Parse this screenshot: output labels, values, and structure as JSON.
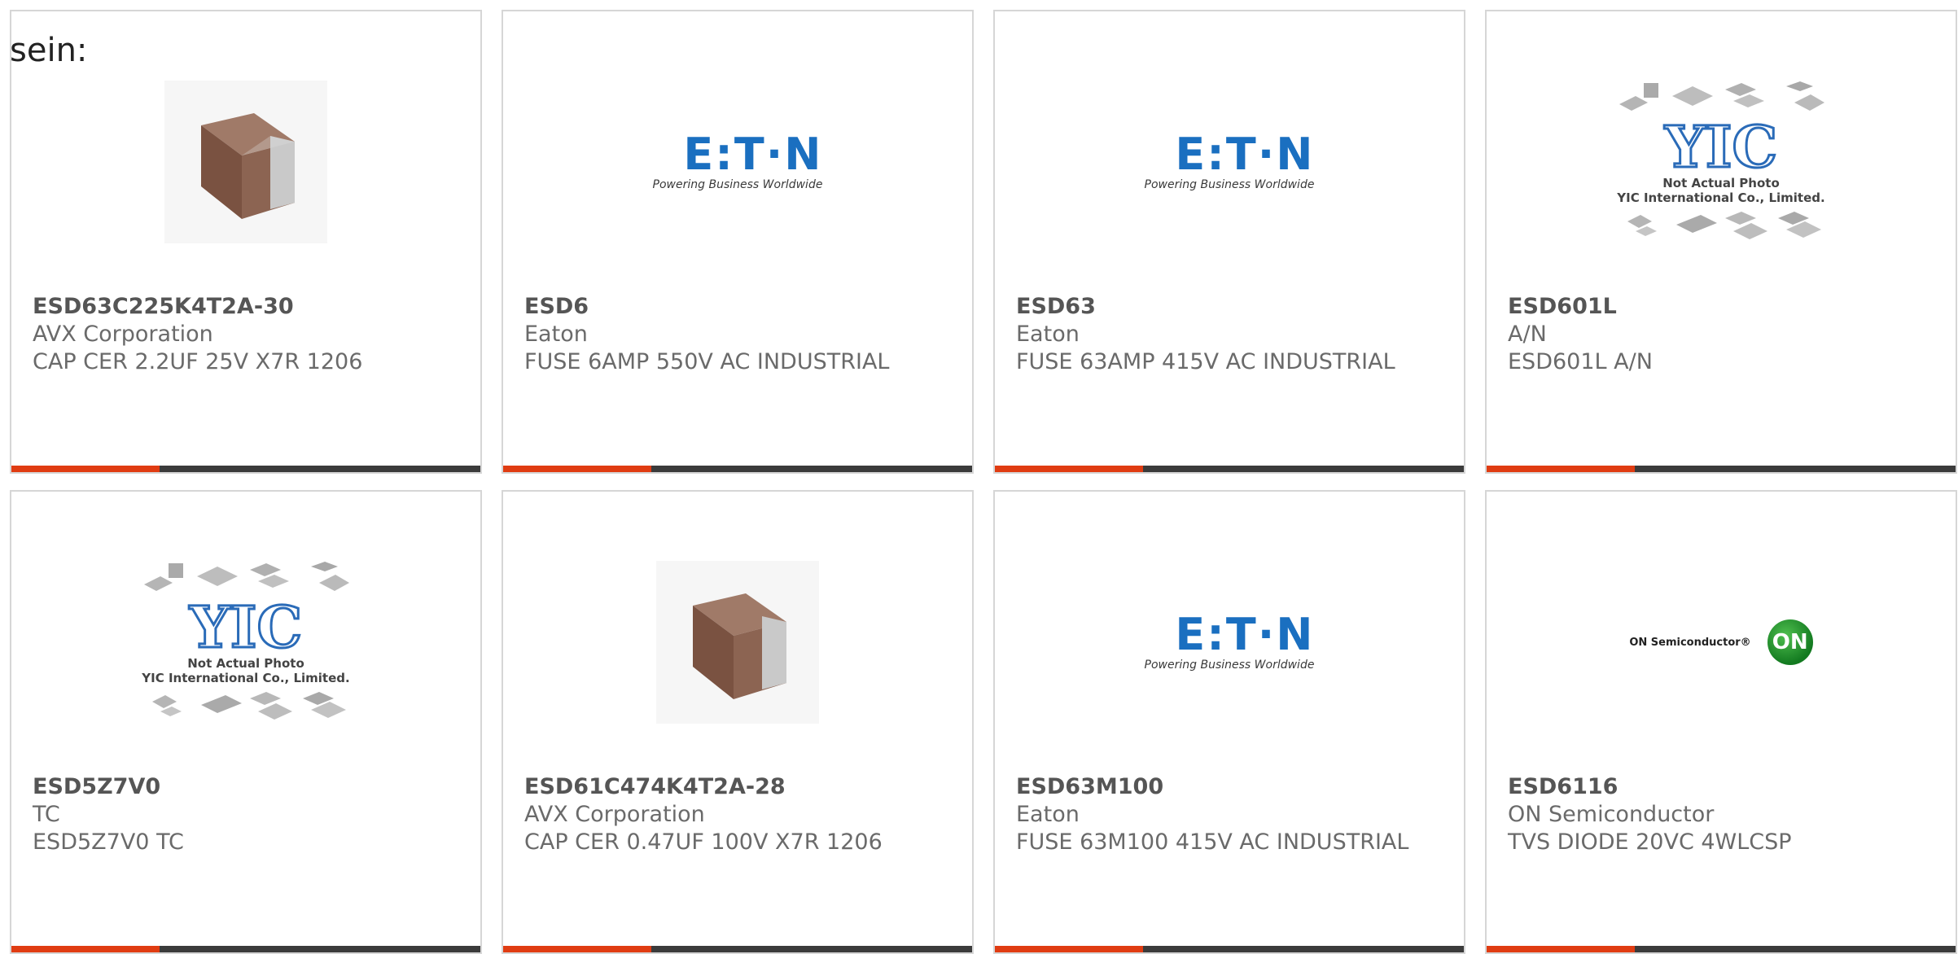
{
  "intro_text": "sein:",
  "colors": {
    "accent": "#e03c12",
    "bar_dark": "#3b3b3b",
    "eaton_blue": "#1a6fc0",
    "on_green": "#137a20",
    "yic_blue": "#2a6bb8"
  },
  "logos": {
    "eaton_word": "E:T·N",
    "eaton_tag": "Powering Business Worldwide",
    "yic_mark": "YIC",
    "yic_caption1": "Not Actual Photo",
    "yic_caption2": "YIC International Co., Limited.",
    "on_name": "ON Semiconductor®",
    "on_mark": "ON"
  },
  "products": [
    {
      "part": "ESD63C225K4T2A-30",
      "manufacturer": "AVX Corporation",
      "description": "CAP CER 2.2UF 25V X7R 1206",
      "image": "capacitor-chip"
    },
    {
      "part": "ESD6",
      "manufacturer": "Eaton",
      "description": "FUSE 6AMP 550V AC INDUSTRIAL",
      "image": "eaton-logo"
    },
    {
      "part": "ESD63",
      "manufacturer": "Eaton",
      "description": "FUSE 63AMP 415V AC INDUSTRIAL",
      "image": "eaton-logo"
    },
    {
      "part": "ESD601L",
      "manufacturer": "A/N",
      "description": "ESD601L A/N",
      "image": "yic-placeholder"
    },
    {
      "part": "ESD5Z7V0",
      "manufacturer": "TC",
      "description": "ESD5Z7V0 TC",
      "image": "yic-placeholder"
    },
    {
      "part": "ESD61C474K4T2A-28",
      "manufacturer": "AVX Corporation",
      "description": "CAP CER 0.47UF 100V X7R 1206",
      "image": "capacitor-chip"
    },
    {
      "part": "ESD63M100",
      "manufacturer": "Eaton",
      "description": "FUSE 63M100 415V AC INDUSTRIAL",
      "image": "eaton-logo"
    },
    {
      "part": "ESD6116",
      "manufacturer": "ON Semiconductor",
      "description": "TVS DIODE 20VC 4WLCSP",
      "image": "on-semi-logo"
    }
  ]
}
